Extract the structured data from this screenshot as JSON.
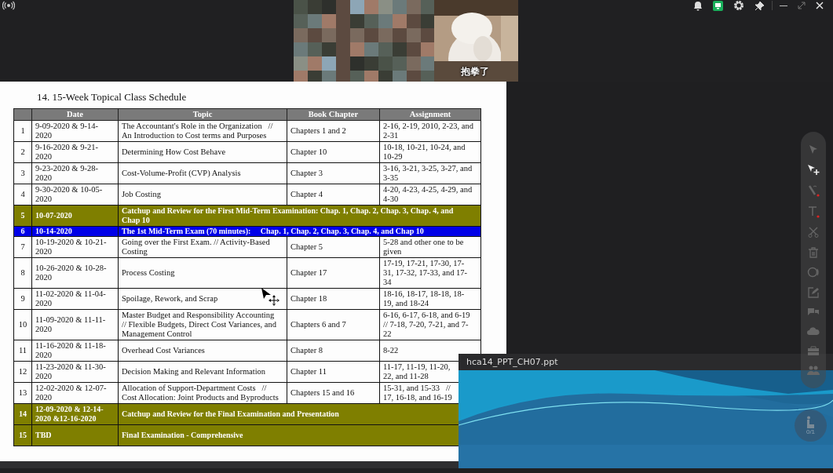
{
  "top_bar": {
    "video_tiles": [
      {
        "kind": "picture"
      },
      {
        "kind": "picture",
        "caption": "抱拳了"
      }
    ]
  },
  "document": {
    "title": "14.  15-Week Topical Class Schedule",
    "table": {
      "columns": [
        "Date",
        "Topic",
        "Book Chapter",
        "Assignment"
      ],
      "rows": [
        {
          "kind": "normal",
          "number": "1",
          "date": "9-09-2020 & 9-14-\n2020",
          "topic": "The Accountant's Role in the Organization   //\nAn Introduction to Cost terms and Purposes",
          "chapter": "Chapters 1 and 2",
          "assignment": "2-16, 2-19, 2010, 2-23, and\n2-31"
        },
        {
          "kind": "normal",
          "number": "2",
          "date": "9-16-2020 & 9-21-\n2020",
          "topic": "Determining How Cost Behave",
          "chapter": "Chapter 10",
          "assignment": "10-18, 10-21, 10-24, and\n10-29"
        },
        {
          "kind": "normal",
          "number": "3",
          "date": "9-23-2020 & 9-28-\n2020",
          "topic": "Cost-Volume-Profit (CVP) Analysis",
          "chapter": "Chapter 3",
          "assignment": "3-16, 3-21, 3-25, 3-27, and\n3-35"
        },
        {
          "kind": "normal",
          "number": "4",
          "date": "9-30-2020 & 10-05-\n2020",
          "topic": "Job Costing",
          "chapter": "Chapter 4",
          "assignment": "4-20, 4-23, 4-25, 4-29, and\n4-30"
        },
        {
          "kind": "review",
          "number": "5",
          "date": "10-07-2020",
          "topic": "Catchup and Review for the First Mid-Term Examination: Chap. 1, Chap. 2, Chap. 3, Chap. 4, and\nChap 10"
        },
        {
          "kind": "exam",
          "number": "6",
          "date": "10-14-2020",
          "topic": "The 1st Mid-Term Exam (70 minutes):     Chap. 1, Chap. 2, Chap. 3, Chap. 4, and Chap 10"
        },
        {
          "kind": "normal",
          "number": "7",
          "date": "10-19-2020 & 10-21-\n2020",
          "topic": "Going over the First Exam. // Activity-Based\nCosting",
          "chapter": "Chapter 5",
          "assignment": "5-28 and other one to be\ngiven"
        },
        {
          "kind": "normal",
          "number": "8",
          "date": "10-26-2020 & 10-28-\n2020",
          "topic": "Process Costing",
          "chapter": "Chapter 17",
          "assignment": "17-19, 17-21, 17-30, 17-\n31, 17-32, 17-33, and 17-\n34"
        },
        {
          "kind": "normal",
          "number": "9",
          "date": "11-02-2020 & 11-04-\n2020",
          "topic": "Spoilage, Rework, and Scrap",
          "chapter": "Chapter 18",
          "assignment": "18-16, 18-17, 18-18, 18-\n19, and 18-24"
        },
        {
          "kind": "normal",
          "number": "10",
          "date": "11-09-2020 & 11-11-\n2020",
          "topic": "Master Budget and Responsibility Accounting\n// Flexible Budgets, Direct Cost Variances, and\nManagement Control",
          "chapter": "Chapters 6 and 7",
          "assignment": "6-16, 6-17, 6-18, and 6-19\n// 7-18, 7-20, 7-21, and 7-\n22"
        },
        {
          "kind": "normal",
          "number": "11",
          "date": "11-16-2020 & 11-18-\n2020",
          "topic": "Overhead Cost Variances",
          "chapter": "Chapter 8",
          "assignment": "8-22"
        },
        {
          "kind": "normal",
          "number": "12",
          "date": "11-23-2020 & 11-30-\n2020",
          "topic": "Decision Making and Relevant Information",
          "chapter": "Chapter 11",
          "assignment": "11-17, 11-19, 11-20,\n22, and 11-28"
        },
        {
          "kind": "normal",
          "number": "13",
          "date": "12-02-2020 & 12-07-\n2020",
          "topic": "Allocation of Support-Department Costs   //\nCost Allocation: Joint Products and Byproducts",
          "chapter": "Chapters 15 and 16",
          "assignment": "15-31, and 15-33   //\n17, 16-18, and 16-19"
        },
        {
          "kind": "review",
          "number": "14",
          "date": "12-09-2020 & 12-14-\n2020 &12-16-2020",
          "topic": "Catchup and Review for the Final Examination and Presentation"
        },
        {
          "kind": "review",
          "number": "15",
          "date": "TBD",
          "topic": "Final Examination - Comprehensive"
        }
      ]
    }
  },
  "file_window": {
    "title": "hca14_PPT_CH07.ppt",
    "preview": {
      "kind": "picture"
    }
  },
  "hand_raise": {
    "count": "0/1"
  }
}
